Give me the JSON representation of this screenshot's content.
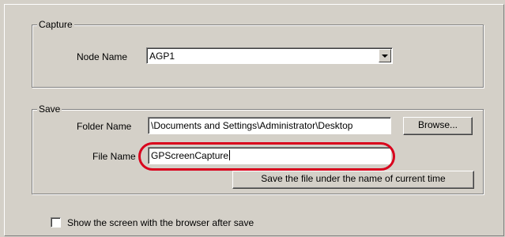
{
  "capture": {
    "legend": "Capture",
    "node_name_label": "Node Name",
    "node_name_value": "AGP1"
  },
  "save": {
    "legend": "Save",
    "folder_name_label": "Folder Name",
    "folder_name_value": "\\Documents and Settings\\Administrator\\Desktop",
    "browse_label": "Browse...",
    "file_name_label": "File Name",
    "file_name_value": "GPScreenCapture",
    "save_time_label": "Save the file under the name of current time"
  },
  "options": {
    "show_browser_label": "Show the screen with the browser after save",
    "show_browser_checked": false
  },
  "colors": {
    "highlight": "#d9001c",
    "face": "#d4d0c8"
  }
}
